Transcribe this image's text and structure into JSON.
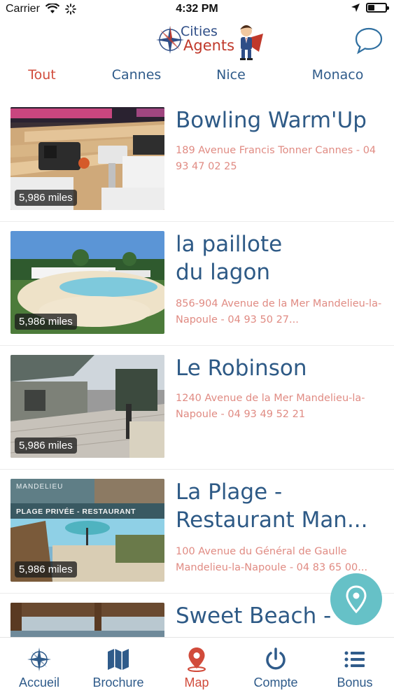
{
  "status_bar": {
    "carrier": "Carrier",
    "time": "4:32 PM"
  },
  "header": {
    "logo_line1": "Cities",
    "logo_line2": "Agents"
  },
  "tabs": [
    {
      "label": "Tout",
      "active": true
    },
    {
      "label": "Cannes",
      "active": false
    },
    {
      "label": "Nice",
      "active": false
    },
    {
      "label": "Monaco",
      "active": false
    }
  ],
  "places": [
    {
      "title": "Bowling Warm'Up",
      "subtitle": "189 Avenue Francis Tonner Cannes - 04 93 47 02 25",
      "distance": "5,986 miles",
      "image": "bowling-alley-photo"
    },
    {
      "title": "la paillote du lagon",
      "subtitle": "856-904 Avenue de la Mer Mandelieu-la-Napoule - 04 93 50 27...",
      "distance": "5,986 miles",
      "image": "lagoon-pool-photo"
    },
    {
      "title": "Le Robinson",
      "subtitle": "1240 Avenue de la Mer Mandelieu-la-Napoule - 04 93 49 52 21",
      "distance": "5,986 miles",
      "image": "wooden-terrace-photo"
    },
    {
      "title": "La Plage - Restaurant Man...",
      "subtitle": "100 Avenue du Général de Gaulle Mandelieu-la-Napoule - 04 83 65 00...",
      "distance": "5,986 miles",
      "image": "beach-restaurant-photo",
      "image_text": {
        "top": "MANDELIEU",
        "banner": "PLAGE PRIVÉE - RESTAURANT"
      }
    },
    {
      "title": "Sweet Beach -",
      "subtitle": "",
      "distance": "",
      "image": "sweet-beach-photo"
    }
  ],
  "bottom_nav": [
    {
      "label": "Accueil",
      "icon": "compass-rose-icon",
      "active": false
    },
    {
      "label": "Brochure",
      "icon": "map-icon",
      "active": false
    },
    {
      "label": "Map",
      "icon": "location-pin-icon",
      "active": true
    },
    {
      "label": "Compte",
      "icon": "power-icon",
      "active": false
    },
    {
      "label": "Bonus",
      "icon": "list-icon",
      "active": false
    }
  ],
  "colors": {
    "accent": "#d14b3b",
    "primary": "#2f5b8a",
    "address": "#e08b83",
    "fab": "#66c1c7"
  }
}
